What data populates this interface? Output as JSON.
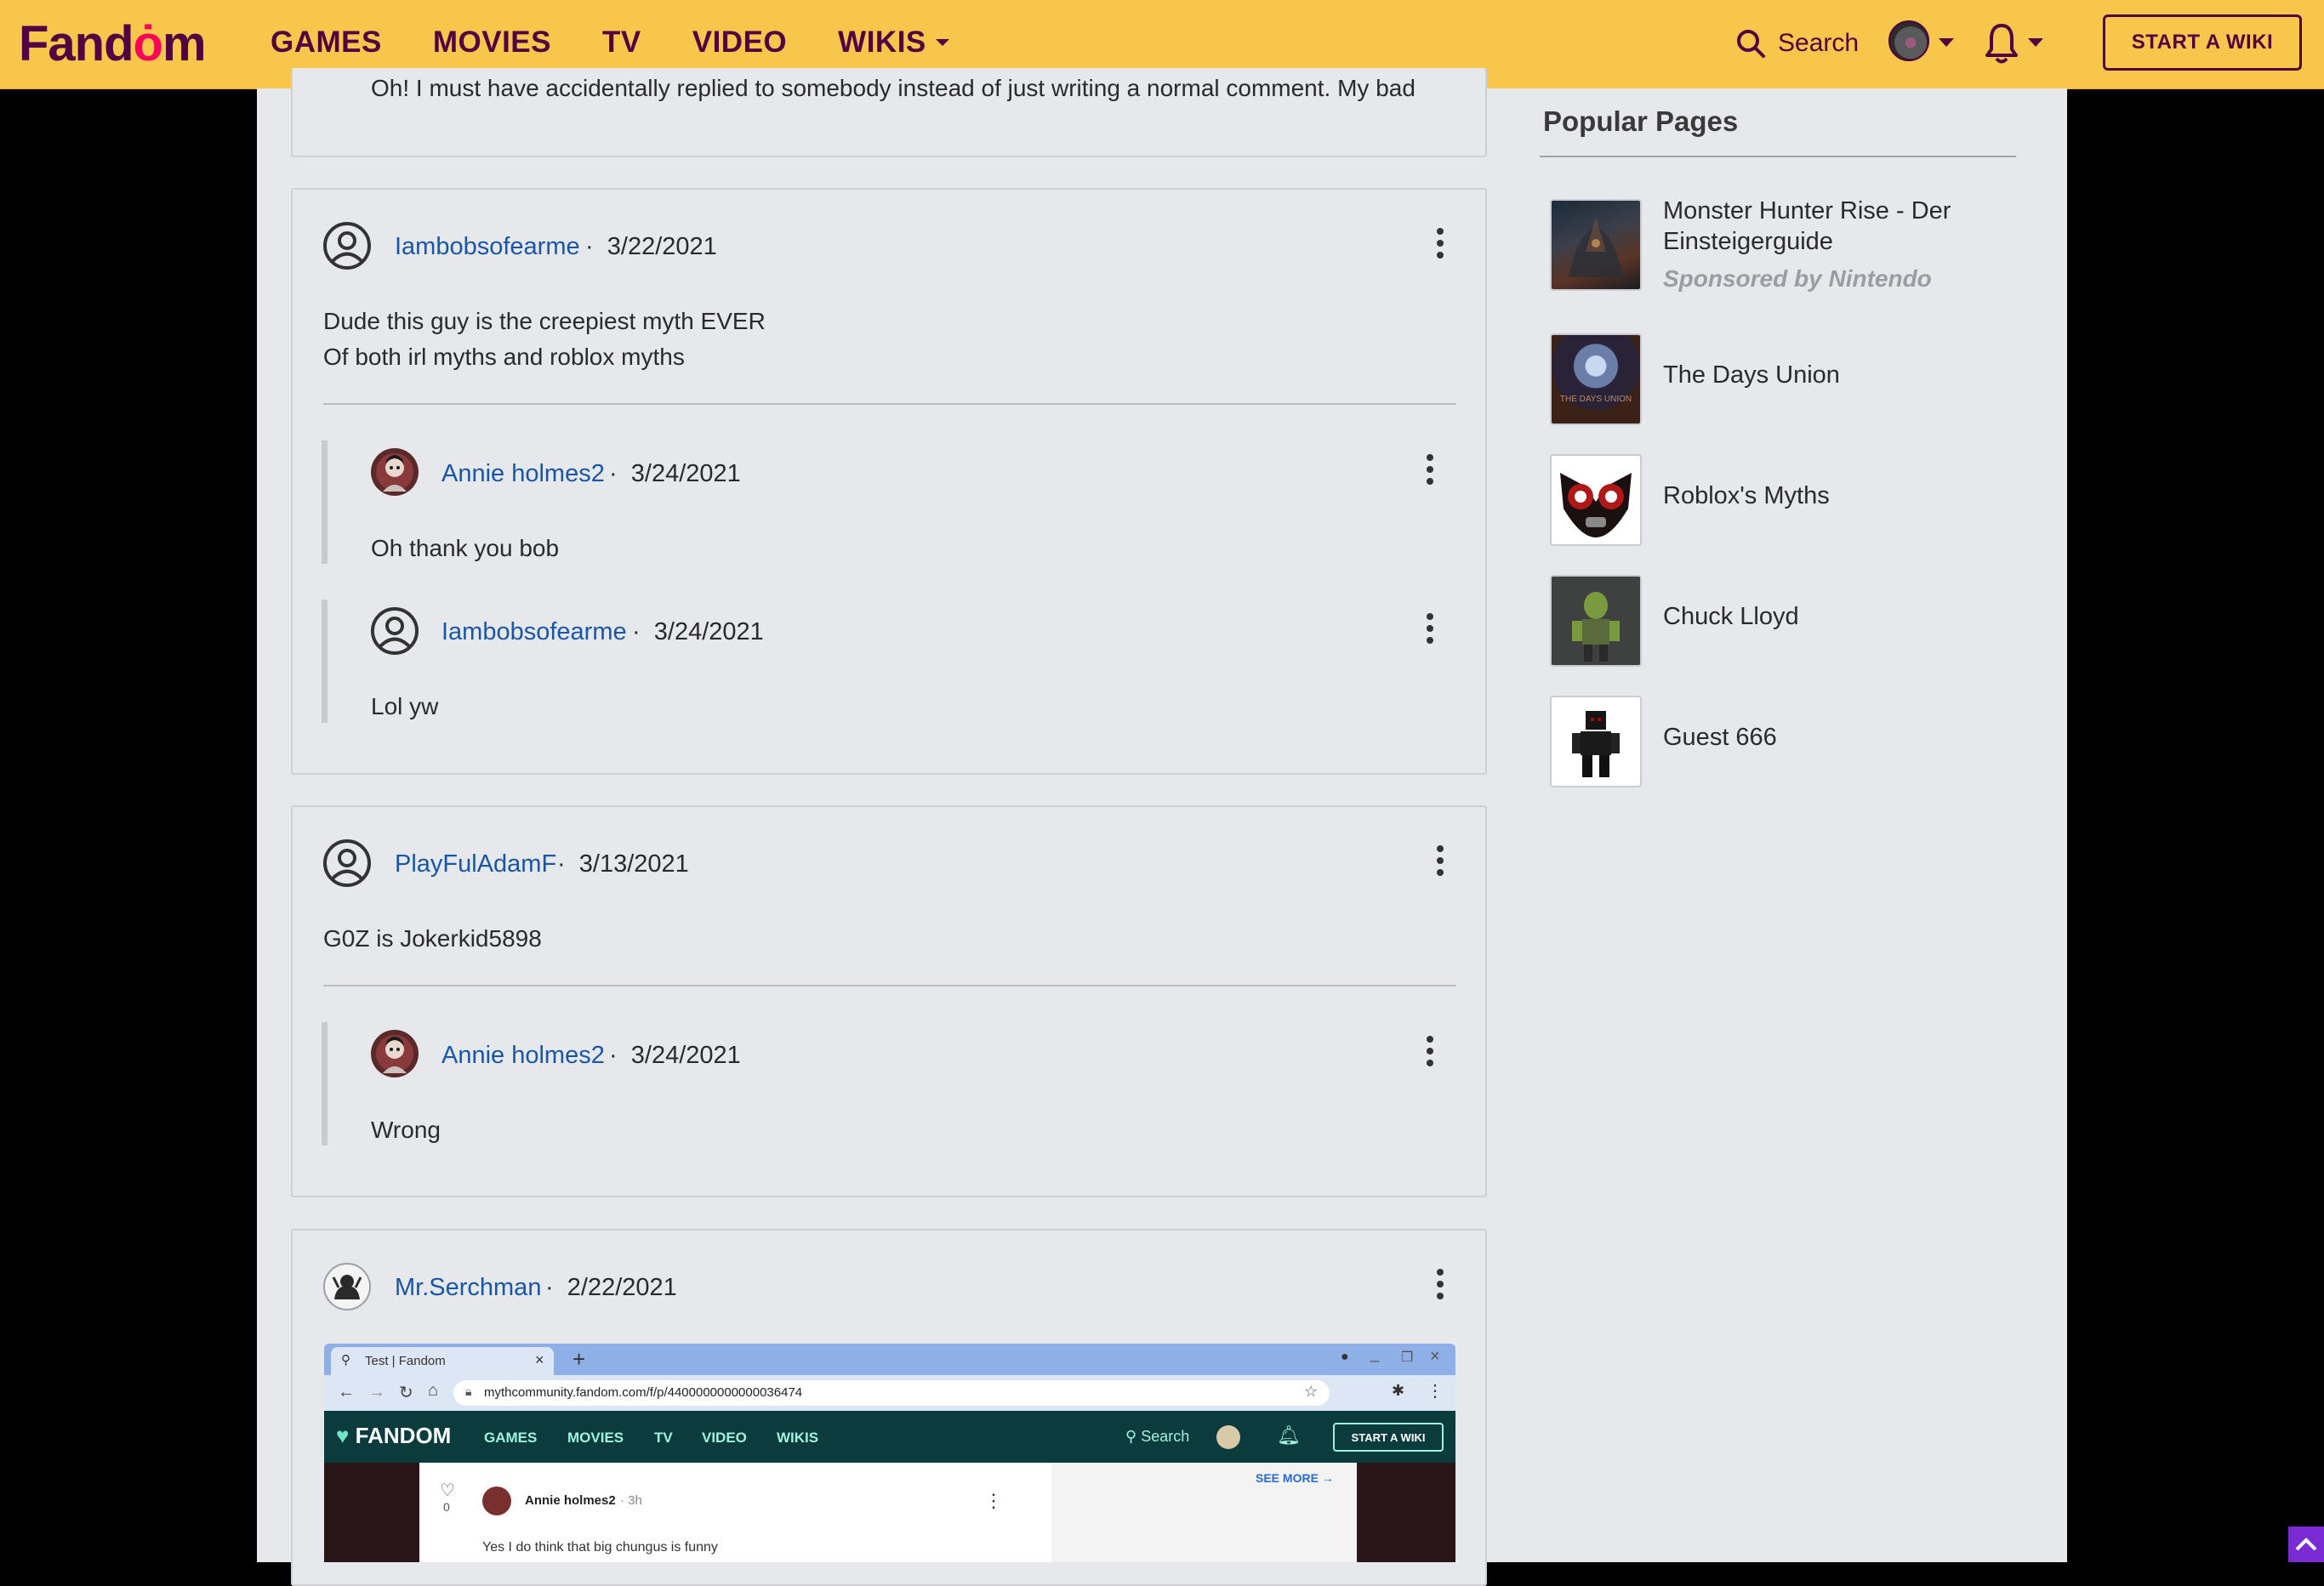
{
  "topnav": {
    "logo": "Fandom",
    "items": [
      "GAMES",
      "MOVIES",
      "TV",
      "VIDEO",
      "WIKIS"
    ],
    "search_label": "Search",
    "start_wiki": "START A WIKI"
  },
  "comments": {
    "partial_text": "Oh! I must have accidentally replied to somebody instead of just writing a normal comment. My bad",
    "thread1": {
      "user": "Iambobsofearme",
      "date": "3/22/2021",
      "line1": "Dude this guy is the creepiest myth EVER",
      "line2": "Of both irl myths and roblox myths",
      "replies": [
        {
          "user": "Annie holmes2",
          "date": "3/24/2021",
          "text": "Oh thank you bob"
        },
        {
          "user": "Iambobsofearme",
          "date": "3/24/2021",
          "text": "Lol yw"
        }
      ]
    },
    "thread2": {
      "user": "PlayFulAdamF",
      "date": "3/13/2021",
      "text": "G0Z is Jokerkid5898",
      "replies": [
        {
          "user": "Annie holmes2",
          "date": "3/24/2021",
          "text": "Wrong"
        }
      ]
    },
    "thread3": {
      "user": "Mr.Serchman",
      "date": "2/22/2021"
    },
    "separator": "·"
  },
  "sidebar": {
    "title": "Popular Pages",
    "items": [
      {
        "label_line1": "Monster Hunter Rise - Der",
        "label_line2": "Einsteigerguide",
        "sponsor": "Sponsored by Nintendo"
      },
      {
        "label": "The Days Union",
        "thumb_text": "THE DAYS UNION"
      },
      {
        "label": "Roblox's Myths"
      },
      {
        "label": "Chuck Lloyd"
      },
      {
        "label": "Guest 666"
      }
    ]
  },
  "embedded_screenshot": {
    "tab_title": "Test | Fandom",
    "url": "mythcommunity.fandom.com/f/p/4400000000000036474",
    "logo": "FANDOM",
    "nav": [
      "GAMES",
      "MOVIES",
      "TV",
      "VIDEO",
      "WIKIS"
    ],
    "search": "Search",
    "start_wiki": "START A WIKI",
    "see_more": "SEE MORE",
    "user": "Annie holmes2",
    "time": "3h",
    "likes": "0",
    "text": "Yes I do think that big chungus is funny"
  },
  "colors": {
    "nav_bg": "#f8c64a",
    "nav_text": "#520044",
    "link": "#1a56a8",
    "page_bg": "#e6e8eb"
  }
}
